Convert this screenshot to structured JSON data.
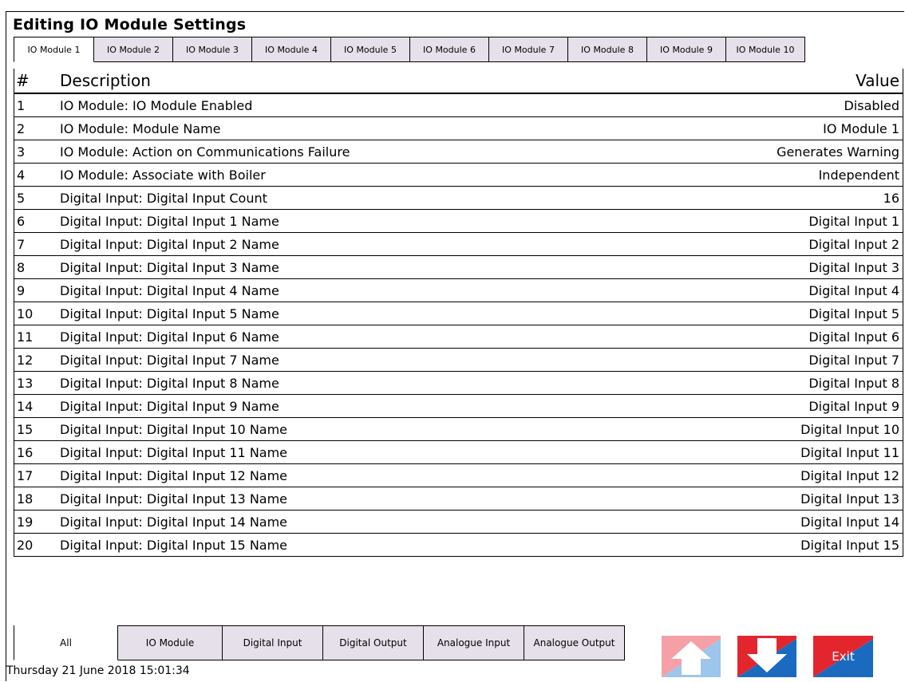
{
  "window": {
    "title": "Editing IO Module Settings"
  },
  "tabs": [
    {
      "label": "IO Module 1",
      "active": true
    },
    {
      "label": "IO Module 2"
    },
    {
      "label": "IO Module 3"
    },
    {
      "label": "IO Module 4"
    },
    {
      "label": "IO Module 5"
    },
    {
      "label": "IO Module 6"
    },
    {
      "label": "IO Module 7"
    },
    {
      "label": "IO Module 8"
    },
    {
      "label": "IO Module 9"
    },
    {
      "label": "IO Module 10"
    }
  ],
  "table": {
    "headers": {
      "num": "#",
      "description": "Description",
      "value": "Value"
    },
    "rows": [
      {
        "num": "1",
        "description": "IO Module: IO Module Enabled",
        "value": "Disabled"
      },
      {
        "num": "2",
        "description": "IO Module: Module Name",
        "value": "IO Module 1"
      },
      {
        "num": "3",
        "description": "IO Module: Action on Communications Failure",
        "value": "Generates Warning"
      },
      {
        "num": "4",
        "description": "IO Module: Associate with Boiler",
        "value": "Independent"
      },
      {
        "num": "5",
        "description": "Digital Input: Digital Input Count",
        "value": "16"
      },
      {
        "num": "6",
        "description": "Digital Input: Digital Input 1 Name",
        "value": "Digital Input 1"
      },
      {
        "num": "7",
        "description": "Digital Input: Digital Input 2 Name",
        "value": "Digital Input 2"
      },
      {
        "num": "8",
        "description": "Digital Input: Digital Input 3 Name",
        "value": "Digital Input 3"
      },
      {
        "num": "9",
        "description": "Digital Input: Digital Input 4 Name",
        "value": "Digital Input 4"
      },
      {
        "num": "10",
        "description": "Digital Input: Digital Input 5 Name",
        "value": "Digital Input 5"
      },
      {
        "num": "11",
        "description": "Digital Input: Digital Input 6 Name",
        "value": "Digital Input 6"
      },
      {
        "num": "12",
        "description": "Digital Input: Digital Input 7 Name",
        "value": "Digital Input 7"
      },
      {
        "num": "13",
        "description": "Digital Input: Digital Input 8 Name",
        "value": "Digital Input 8"
      },
      {
        "num": "14",
        "description": "Digital Input: Digital Input 9 Name",
        "value": "Digital Input 9"
      },
      {
        "num": "15",
        "description": "Digital Input: Digital Input 10 Name",
        "value": "Digital Input 10"
      },
      {
        "num": "16",
        "description": "Digital Input: Digital Input 11 Name",
        "value": "Digital Input 11"
      },
      {
        "num": "17",
        "description": "Digital Input: Digital Input 12 Name",
        "value": "Digital Input 12"
      },
      {
        "num": "18",
        "description": "Digital Input: Digital Input 13 Name",
        "value": "Digital Input 13"
      },
      {
        "num": "19",
        "description": "Digital Input: Digital Input 14 Name",
        "value": "Digital Input 14"
      },
      {
        "num": "20",
        "description": "Digital Input: Digital Input 15 Name",
        "value": "Digital Input 15"
      }
    ]
  },
  "filters": [
    {
      "label": "All",
      "active": true
    },
    {
      "label": "IO Module"
    },
    {
      "label": "Digital Input"
    },
    {
      "label": "Digital Output"
    },
    {
      "label": "Analogue Input"
    },
    {
      "label": "Analogue Output"
    }
  ],
  "buttons": {
    "scroll_up_icon": "arrow-up-icon",
    "scroll_down_icon": "arrow-down-icon",
    "exit_label": "Exit"
  },
  "colors": {
    "tab_bg": "#e6e0ea",
    "up_button": "#f4a0a6",
    "down_button": "#e3262e",
    "exit_button": "#e3262e",
    "accent_blue": "#1a6bc0"
  },
  "footer": {
    "timestamp": "Thursday 21 June 2018 15:01:34"
  }
}
